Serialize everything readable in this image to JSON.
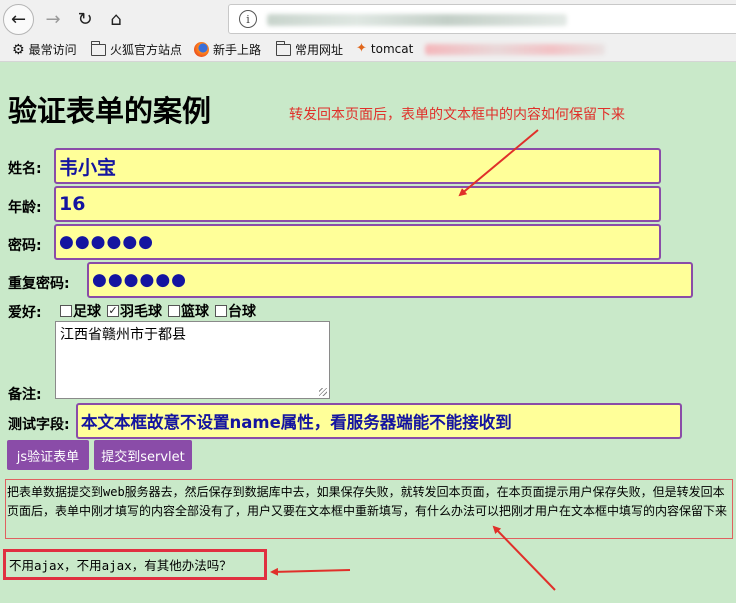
{
  "browser": {
    "bookmarks": [
      "最常访问",
      "火狐官方站点",
      "新手上路",
      "常用网址",
      "tomcat"
    ]
  },
  "page": {
    "title": "验证表单的案例",
    "note": "转发回本页面后，表单的文本框中的内容如何保留下来"
  },
  "form": {
    "name_label": "姓名:",
    "name_value": "韦小宝",
    "age_label": "年龄:",
    "age_value": "16",
    "password_label": "密码:",
    "password_value": "●●●●●●",
    "repeat_label": "重复密码:",
    "repeat_value": "●●●●●●",
    "hobby_label": "爱好:",
    "hobbies": [
      {
        "label": "足球",
        "checked": false
      },
      {
        "label": "羽毛球",
        "checked": true
      },
      {
        "label": "篮球",
        "checked": false
      },
      {
        "label": "台球",
        "checked": false
      }
    ],
    "remark_label": "备注:",
    "remark_value": "江西省赣州市于都县",
    "test_label": "测试字段:",
    "test_value": "本文本框故意不设置name属性，看服务器端能不能接收到",
    "js_button": "js验证表单",
    "submit_button": "提交到servlet"
  },
  "explanation": "把表单数据提交到web服务器去，然后保存到数据库中去，如果保存失败，就转发回本页面，在本页面提示用户保存失败，但是转发回本页面后，表单中刚才填写的内容全部没有了，用户又要在文本框中重新填写，有什么办法可以把刚才用户在文本框中填写的内容保留下来",
  "question": "不用ajax，不用ajax，有其他办法吗？",
  "colors": {
    "page_bg": "#c9e9c9",
    "field_bg": "#ffff99",
    "field_border": "#8a4ca8",
    "field_text": "#1414a0",
    "annotation_red": "#e0302a"
  }
}
